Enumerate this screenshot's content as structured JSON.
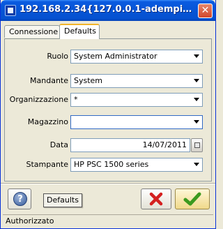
{
  "window": {
    "title": "192.168.2.34{127.0.0.1-adempiere-a..."
  },
  "tabs": [
    {
      "label": "Connessione"
    },
    {
      "label": "Defaults"
    }
  ],
  "form": {
    "ruolo": {
      "label": "Ruolo",
      "value": "System Administrator"
    },
    "mandante": {
      "label": "Mandante",
      "value": "System"
    },
    "organizzazione": {
      "label": "Organizzazione",
      "value": "*"
    },
    "magazzino": {
      "label": "Magazzino",
      "value": ""
    },
    "data": {
      "label": "Data",
      "value": "14/07/2011"
    },
    "stampante": {
      "label": "Stampante",
      "value": "HP PSC 1500 series"
    }
  },
  "tooltip": {
    "text": "Defaults"
  },
  "status": {
    "text": "Authorizzato"
  },
  "colors": {
    "titlebar": "#0756d8",
    "active_tab_accent": "#f2b42a",
    "cancel": "#d42020",
    "ok": "#3c9a1e"
  },
  "icons": {
    "help": "help-icon",
    "cancel": "cancel-x-icon",
    "ok": "check-icon",
    "calendar": "calendar-icon",
    "close": "close-icon"
  }
}
